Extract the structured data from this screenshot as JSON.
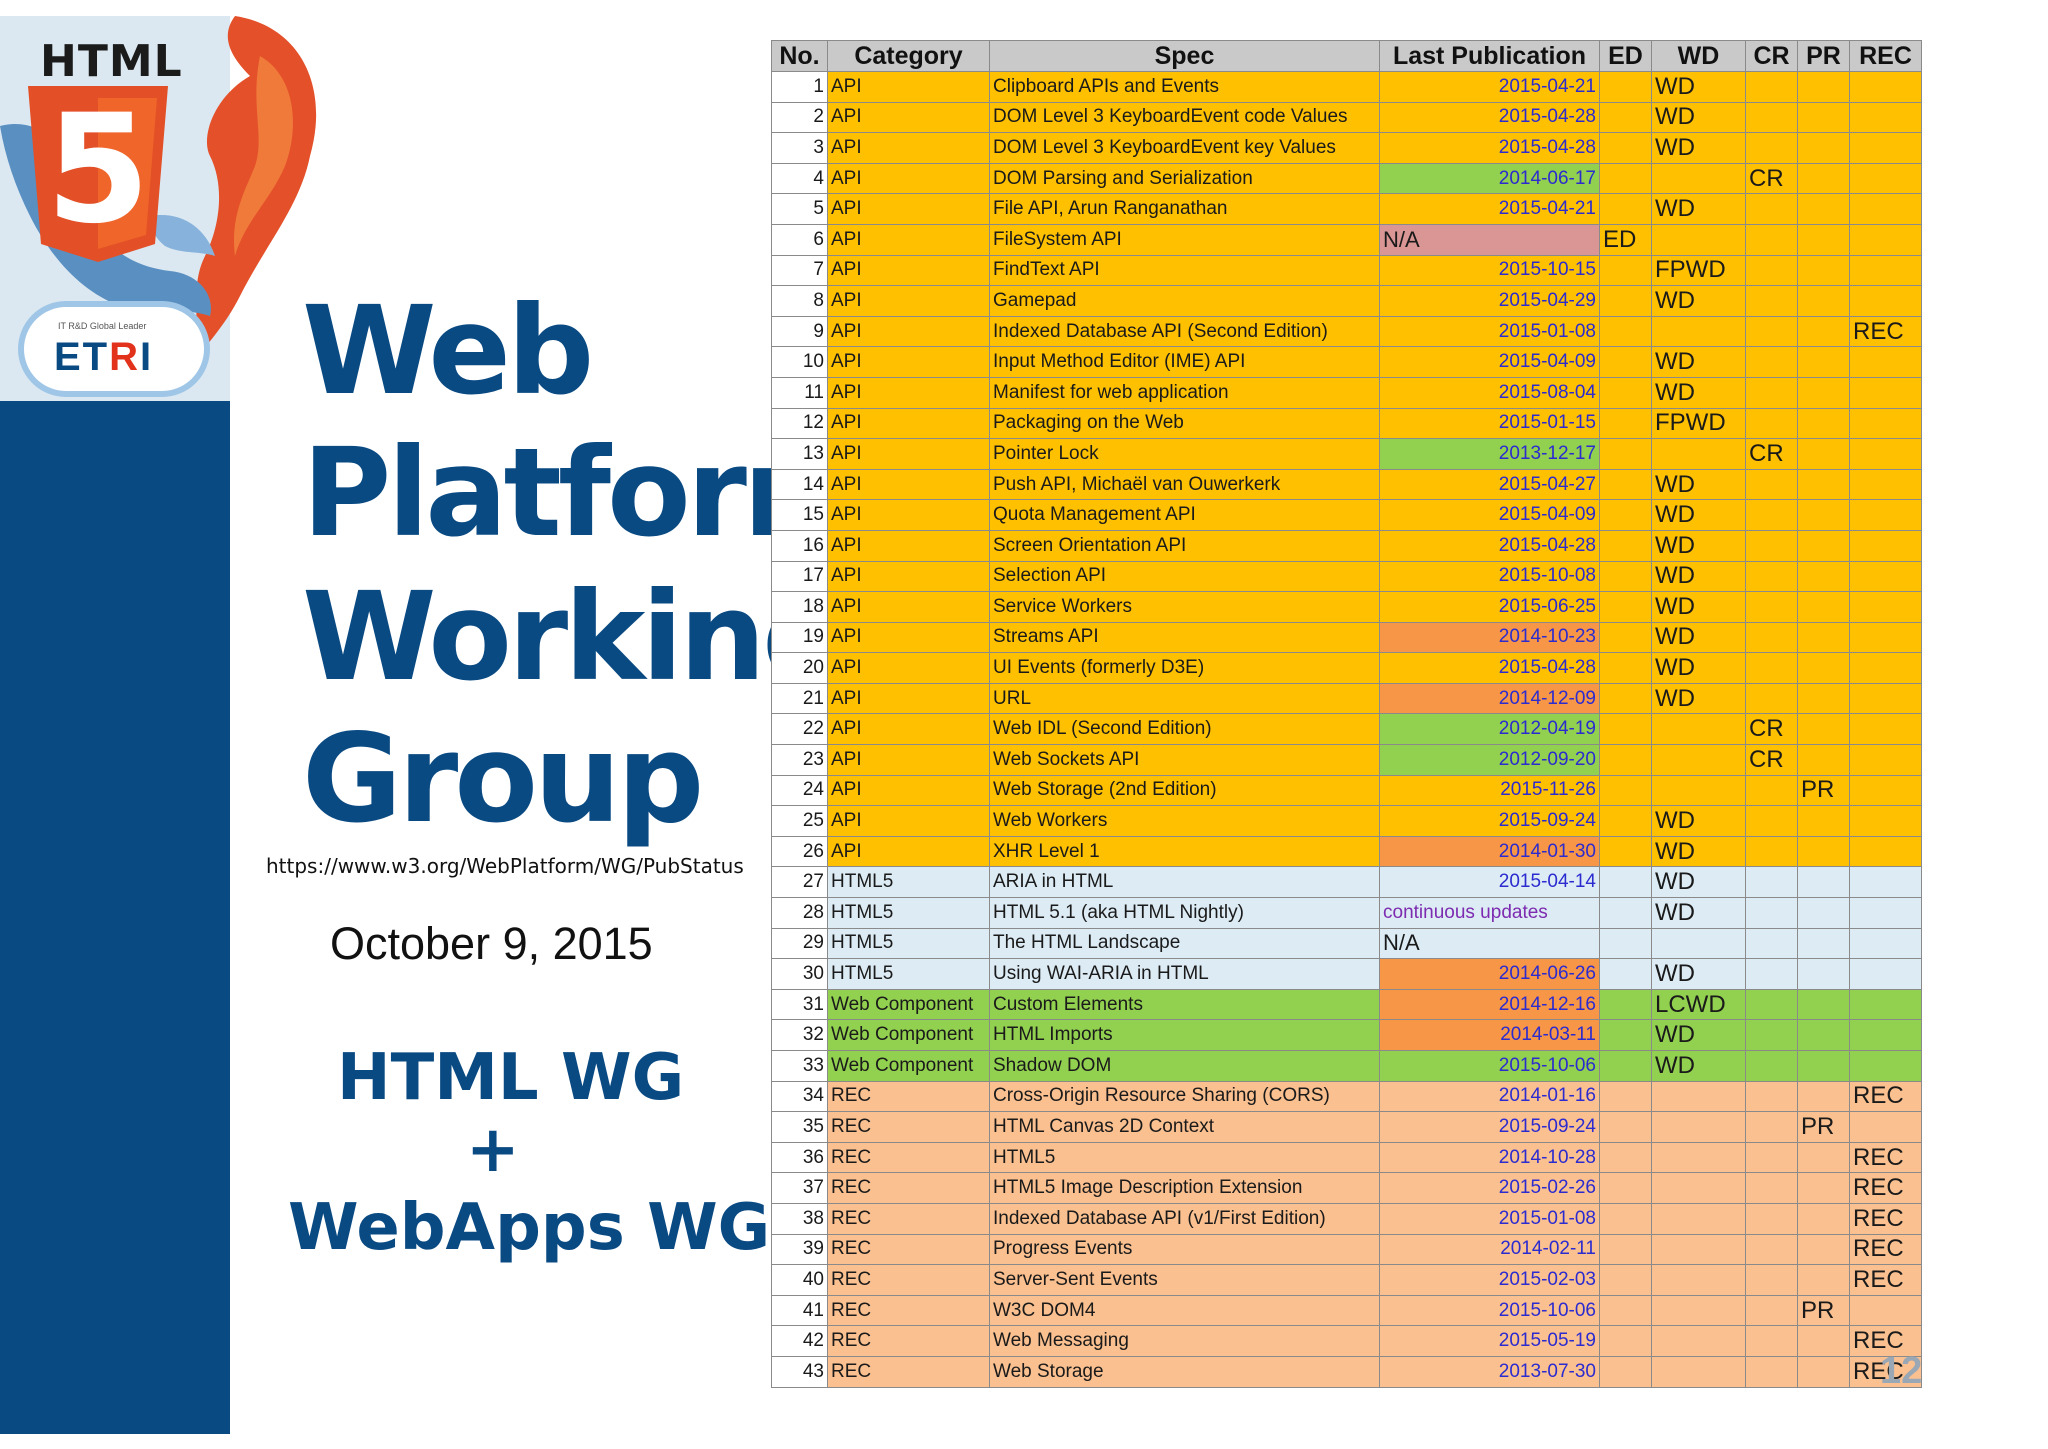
{
  "logo": {
    "html_word": "HTML",
    "shield_digit": "5",
    "etri_tagline": "IT R&D Global Leader",
    "etri_prefix": "ET",
    "etri_r": "R",
    "etri_suffix": "I"
  },
  "title": {
    "line1": "Web",
    "line2": "Platform",
    "line3": "Working",
    "line4": "Group"
  },
  "url": "https://www.w3.org/WebPlatform/WG/PubStatus",
  "date": "October 9, 2015",
  "wg": {
    "line1": "HTML WG",
    "plus": "+",
    "line2": "WebApps WG"
  },
  "colors": {
    "brand_blue": "#0a4a83",
    "api": "#ffc000",
    "html5": "#dcebf4",
    "web_component": "#92d050",
    "rec": "#fac090",
    "pub_green": "#92d050",
    "pub_orange": "#f79646",
    "pub_pink": "#d99694",
    "date_blue": "#2b2bd0"
  },
  "table": {
    "headers": [
      "No.",
      "Category",
      "Spec",
      "Last Publication",
      "ED",
      "WD",
      "CR",
      "PR",
      "REC"
    ],
    "rows": [
      {
        "no": "1",
        "category": "API",
        "spec": "Clipboard APIs and Events",
        "pub": "2015-04-21",
        "status": "WD"
      },
      {
        "no": "2",
        "category": "API",
        "spec": "DOM Level 3 KeyboardEvent code Values",
        "pub": "2015-04-28",
        "status": "WD"
      },
      {
        "no": "3",
        "category": "API",
        "spec": "DOM Level 3 KeyboardEvent key Values",
        "pub": "2015-04-28",
        "status": "WD"
      },
      {
        "no": "4",
        "category": "API",
        "spec": "DOM Parsing and Serialization",
        "pub": "2014-06-17",
        "status": "CR"
      },
      {
        "no": "5",
        "category": "API",
        "spec": "File API, Arun Ranganathan",
        "pub": "2015-04-21",
        "status": "WD"
      },
      {
        "no": "6",
        "category": "API",
        "spec": "FileSystem API",
        "pub": "N/A",
        "status": "ED"
      },
      {
        "no": "7",
        "category": "API",
        "spec": "FindText API",
        "pub": "2015-10-15",
        "status": "FPWD"
      },
      {
        "no": "8",
        "category": "API",
        "spec": "Gamepad",
        "pub": "2015-04-29",
        "status": "WD"
      },
      {
        "no": "9",
        "category": "API",
        "spec": "Indexed Database API (Second Edition)",
        "pub": "2015-01-08",
        "status": "REC"
      },
      {
        "no": "10",
        "category": "API",
        "spec": "Input Method Editor (IME) API",
        "pub": "2015-04-09",
        "status": "WD"
      },
      {
        "no": "11",
        "category": "API",
        "spec": "Manifest for web application",
        "pub": "2015-08-04",
        "status": "WD"
      },
      {
        "no": "12",
        "category": "API",
        "spec": "Packaging on the Web",
        "pub": "2015-01-15",
        "status": "FPWD"
      },
      {
        "no": "13",
        "category": "API",
        "spec": "Pointer Lock",
        "pub": "2013-12-17",
        "status": "CR"
      },
      {
        "no": "14",
        "category": "API",
        "spec": "Push API, Michaël van Ouwerkerk",
        "pub": "2015-04-27",
        "status": "WD"
      },
      {
        "no": "15",
        "category": "API",
        "spec": "Quota Management API",
        "pub": "2015-04-09",
        "status": "WD"
      },
      {
        "no": "16",
        "category": "API",
        "spec": "Screen Orientation API",
        "pub": "2015-04-28",
        "status": "WD"
      },
      {
        "no": "17",
        "category": "API",
        "spec": "Selection API",
        "pub": "2015-10-08",
        "status": "WD"
      },
      {
        "no": "18",
        "category": "API",
        "spec": "Service Workers",
        "pub": "2015-06-25",
        "status": "WD"
      },
      {
        "no": "19",
        "category": "API",
        "spec": "Streams API",
        "pub": "2014-10-23",
        "status": "WD"
      },
      {
        "no": "20",
        "category": "API",
        "spec": "UI Events (formerly D3E)",
        "pub": "2015-04-28",
        "status": "WD"
      },
      {
        "no": "21",
        "category": "API",
        "spec": "URL",
        "pub": "2014-12-09",
        "status": "WD"
      },
      {
        "no": "22",
        "category": "API",
        "spec": "Web IDL (Second Edition)",
        "pub": "2012-04-19",
        "status": "CR"
      },
      {
        "no": "23",
        "category": "API",
        "spec": "Web Sockets API",
        "pub": "2012-09-20",
        "status": "CR"
      },
      {
        "no": "24",
        "category": "API",
        "spec": "Web Storage (2nd Edition)",
        "pub": "2015-11-26",
        "status": "PR"
      },
      {
        "no": "25",
        "category": "API",
        "spec": "Web Workers",
        "pub": "2015-09-24",
        "status": "WD"
      },
      {
        "no": "26",
        "category": "API",
        "spec": "XHR Level 1",
        "pub": "2014-01-30",
        "status": "WD"
      },
      {
        "no": "27",
        "category": "HTML5",
        "spec": "ARIA in HTML",
        "pub": "2015-04-14",
        "status": "WD"
      },
      {
        "no": "28",
        "category": "HTML5",
        "spec": "HTML 5.1 (aka HTML Nightly)",
        "pub": "continuous updates",
        "status": "WD"
      },
      {
        "no": "29",
        "category": "HTML5",
        "spec": "The HTML Landscape",
        "pub": "N/A",
        "status": ""
      },
      {
        "no": "30",
        "category": "HTML5",
        "spec": "Using WAI-ARIA in HTML",
        "pub": "2014-06-26",
        "status": "WD"
      },
      {
        "no": "31",
        "category": "Web Component",
        "spec": "Custom Elements",
        "pub": "2014-12-16",
        "status": "LCWD"
      },
      {
        "no": "32",
        "category": "Web Component",
        "spec": "HTML Imports",
        "pub": "2014-03-11",
        "status": "WD"
      },
      {
        "no": "33",
        "category": "Web Component",
        "spec": "Shadow DOM",
        "pub": "2015-10-06",
        "status": "WD"
      },
      {
        "no": "34",
        "category": "REC",
        "spec": "Cross-Origin Resource Sharing (CORS)",
        "pub": "2014-01-16",
        "status": "REC"
      },
      {
        "no": "35",
        "category": "REC",
        "spec": "HTML Canvas 2D Context",
        "pub": "2015-09-24",
        "status": "PR"
      },
      {
        "no": "36",
        "category": "REC",
        "spec": "HTML5",
        "pub": "2014-10-28",
        "status": "REC"
      },
      {
        "no": "37",
        "category": "REC",
        "spec": "HTML5 Image Description Extension",
        "pub": "2015-02-26",
        "status": "REC"
      },
      {
        "no": "38",
        "category": "REC",
        "spec": "Indexed Database API (v1/First Edition)",
        "pub": "2015-01-08",
        "status": "REC"
      },
      {
        "no": "39",
        "category": "REC",
        "spec": "Progress Events",
        "pub": "2014-02-11",
        "status": "REC"
      },
      {
        "no": "40",
        "category": "REC",
        "spec": "Server-Sent Events",
        "pub": "2015-02-03",
        "status": "REC"
      },
      {
        "no": "41",
        "category": "REC",
        "spec": "W3C DOM4",
        "pub": "2015-10-06",
        "status": "PR"
      },
      {
        "no": "42",
        "category": "REC",
        "spec": "Web Messaging",
        "pub": "2015-05-19",
        "status": "REC"
      },
      {
        "no": "43",
        "category": "REC",
        "spec": "Web Storage",
        "pub": "2013-07-30",
        "status": "REC"
      }
    ]
  },
  "page_number": "12"
}
